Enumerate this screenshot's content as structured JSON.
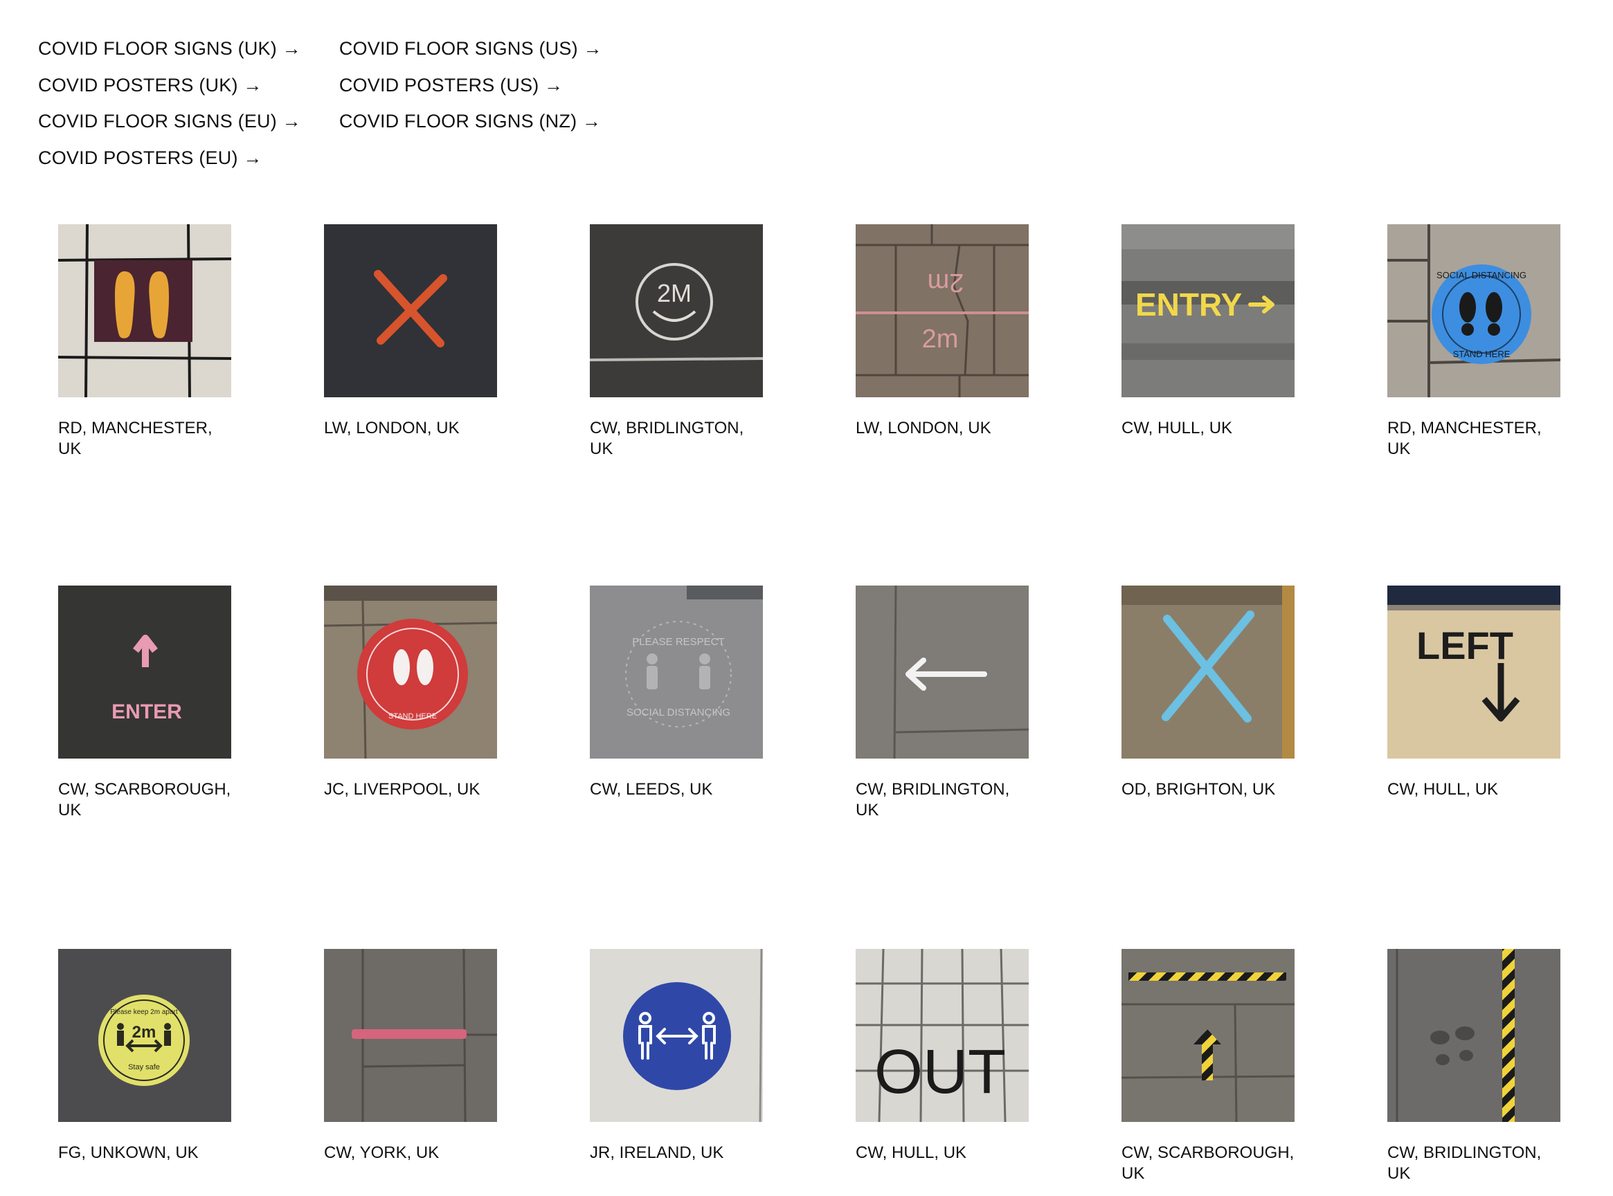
{
  "nav": {
    "left": [
      "COVID FLOOR SIGNS (UK) →",
      "COVID POSTERS (UK) →",
      "COVID FLOOR SIGNS (EU) →",
      "COVID POSTERS (EU) →"
    ],
    "right": [
      "COVID FLOOR SIGNS (US) →",
      "COVID POSTERS (US) →",
      "COVID FLOOR SIGNS (NZ) →"
    ]
  },
  "gallery": [
    {
      "caption": "RD, MANCHESTER, UK",
      "icon": "footprints-floor-sign-icon"
    },
    {
      "caption": "LW, LONDON, UK",
      "icon": "orange-cross-floor-sign-icon"
    },
    {
      "caption": "CW, BRIDLINGTON, UK",
      "icon": "chalk-2m-smiley-icon"
    },
    {
      "caption": "LW, LONDON, UK",
      "icon": "chalk-2m-paving-icon"
    },
    {
      "caption": "CW, HULL, UK",
      "icon": "entry-arrow-sign-icon"
    },
    {
      "caption": "RD, MANCHESTER, UK",
      "icon": "social-distancing-stand-here-icon"
    },
    {
      "caption": "CW, SCARBOROUGH, UK",
      "icon": "enter-arrow-sign-icon"
    },
    {
      "caption": "JC, LIVERPOOL, UK",
      "icon": "red-stand-here-sign-icon"
    },
    {
      "caption": "CW, LEEDS, UK",
      "icon": "please-respect-social-distancing-icon"
    },
    {
      "caption": "CW, BRIDLINGTON, UK",
      "icon": "chalk-left-arrow-icon"
    },
    {
      "caption": "OD, BRIGHTON, UK",
      "icon": "blue-cross-floor-sign-icon"
    },
    {
      "caption": "CW, HULL, UK",
      "icon": "left-down-arrow-sign-icon"
    },
    {
      "caption": "FG, UNKOWN, UK",
      "icon": "yellow-2m-stay-safe-sign-icon"
    },
    {
      "caption": "CW, YORK, UK",
      "icon": "pink-tape-line-icon"
    },
    {
      "caption": "JR, IRELAND, UK",
      "icon": "blue-distance-sign-icon"
    },
    {
      "caption": "CW, HULL, UK",
      "icon": "out-tape-letters-icon"
    },
    {
      "caption": "CW, SCARBOROUGH, UK",
      "icon": "hazard-tape-arrow-icon"
    },
    {
      "caption": "CW, BRIDLINGTON, UK",
      "icon": "hazard-tape-vertical-icon"
    }
  ],
  "thumb_text": {
    "two_m": "2M",
    "two_m_lower": "2m",
    "entry": "ENTRY",
    "social_distancing": "SOCIAL DISTANCING",
    "stand_here": "STAND HERE",
    "enter": "ENTER",
    "please_respect": "PLEASE RESPECT",
    "social_distancing_mixed": "SOCIAL DISTANCING",
    "left": "LEFT",
    "please_keep_2m_apart": "Please keep 2m apart",
    "stay_safe": "Stay safe",
    "out": "OUT"
  }
}
